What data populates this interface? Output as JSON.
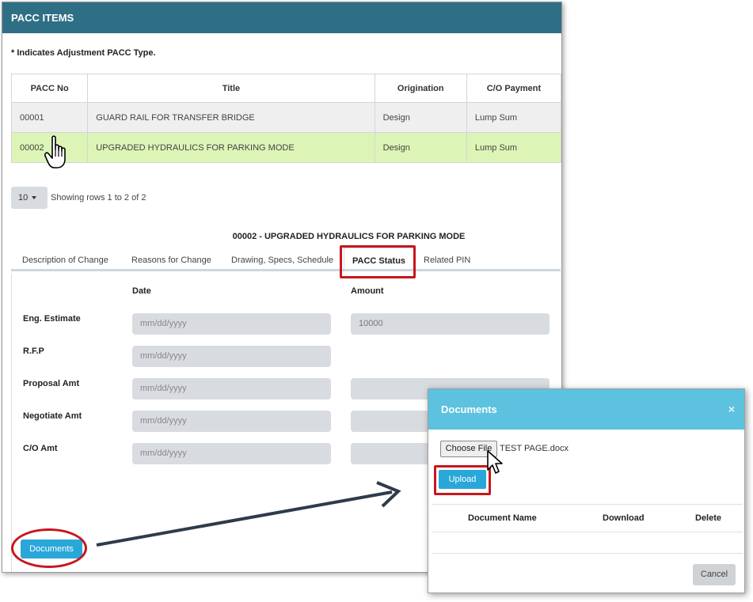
{
  "panel": {
    "title": "PACC ITEMS",
    "note": "* Indicates Adjustment PACC Type."
  },
  "table": {
    "headers": [
      "PACC No",
      "Title",
      "Origination",
      "C/O Payment"
    ],
    "rows": [
      [
        "00001",
        "GUARD RAIL FOR TRANSFER BRIDGE",
        "Design",
        "Lump Sum"
      ],
      [
        "00002",
        "UPGRADED HYDRAULICS FOR PARKING MODE",
        "Design",
        "Lump Sum"
      ]
    ],
    "selected_row_color": "#dcf5b6"
  },
  "pager": {
    "page_size": "10",
    "summary": "Showing rows 1 to 2 of 2"
  },
  "detail": {
    "title": "00002 - UPGRADED HYDRAULICS FOR PARKING MODE",
    "tabs": [
      "Description of Change",
      "Reasons for Change",
      "Drawing, Specs, Schedule",
      "PACC Status",
      "Related PIN"
    ],
    "active_tab": "PACC Status"
  },
  "status_form": {
    "date_header": "Date",
    "amount_header": "Amount",
    "date_placeholder": "mm/dd/yyyy",
    "rows": [
      {
        "label": "Eng. Estimate",
        "amount": "10000"
      },
      {
        "label": "R.F.P"
      },
      {
        "label": "Proposal Amt"
      },
      {
        "label": "Negotiate Amt"
      },
      {
        "label": "C/O Amt"
      }
    ]
  },
  "documents_button": "Documents",
  "modal": {
    "title": "Documents",
    "close": "×",
    "choose_file": "Choose File",
    "file_name": "TEST PAGE.docx",
    "upload": "Upload",
    "columns": [
      "Document Name",
      "Download",
      "Delete"
    ],
    "cancel": "Cancel"
  },
  "colors": {
    "header_bg": "#2f6f85",
    "modal_header_bg": "#5cc2df",
    "primary_button": "#2aa7d9",
    "annotation_red": "#c8161d"
  },
  "icons": [
    "hand-pointer-cursor-icon",
    "arrow-pointer-cursor-icon",
    "caret-down-icon",
    "close-icon"
  ]
}
